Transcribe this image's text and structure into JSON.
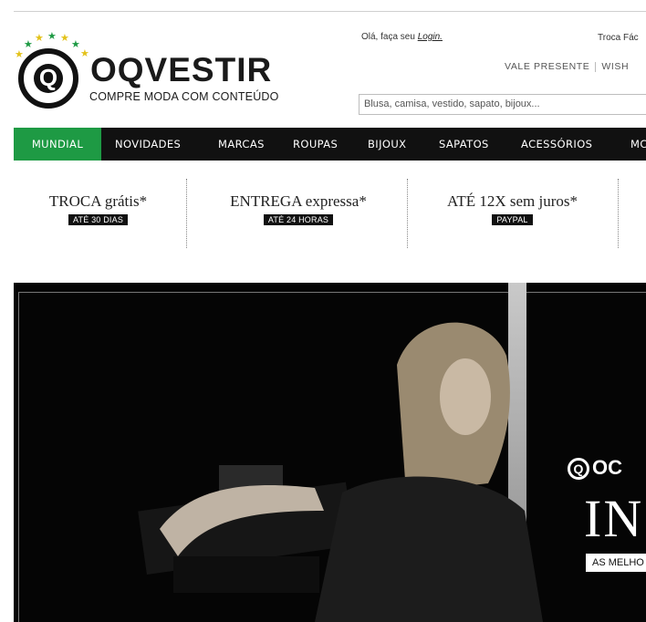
{
  "header": {
    "greeting_prefix": "Olá, faça seu ",
    "login_label": "Login.",
    "troca_text": "Troca Fác",
    "vale_presente": "VALE PRESENTE",
    "wishlist": "WISH",
    "search_placeholder": "Blusa, camisa, vestido, sapato, bijoux..."
  },
  "logo": {
    "name": "OQVESTIR",
    "tagline": "COMPRE MODA COM CONTEÚDO",
    "letter": "Q"
  },
  "nav": {
    "items": [
      "MUNDIAL",
      "NOVIDADES",
      "MARCAS",
      "ROUPAS",
      "BIJOUX",
      "SAPATOS",
      "ACESSÓRIOS",
      "MC"
    ]
  },
  "benefits": [
    {
      "title": "TROCA grátis*",
      "badge": "ATÉ 30 DIAS"
    },
    {
      "title": "ENTREGA expressa*",
      "badge": "ATÉ 24 HORAS"
    },
    {
      "title": "ATÉ 12X sem juros*",
      "badge": "PAYPAL"
    }
  ],
  "hero": {
    "brand_fragment": "OC",
    "big_word": "IN",
    "tagline": "AS MELHO"
  },
  "colors": {
    "accent_green": "#1e9a44",
    "nav_bg": "#111111"
  }
}
